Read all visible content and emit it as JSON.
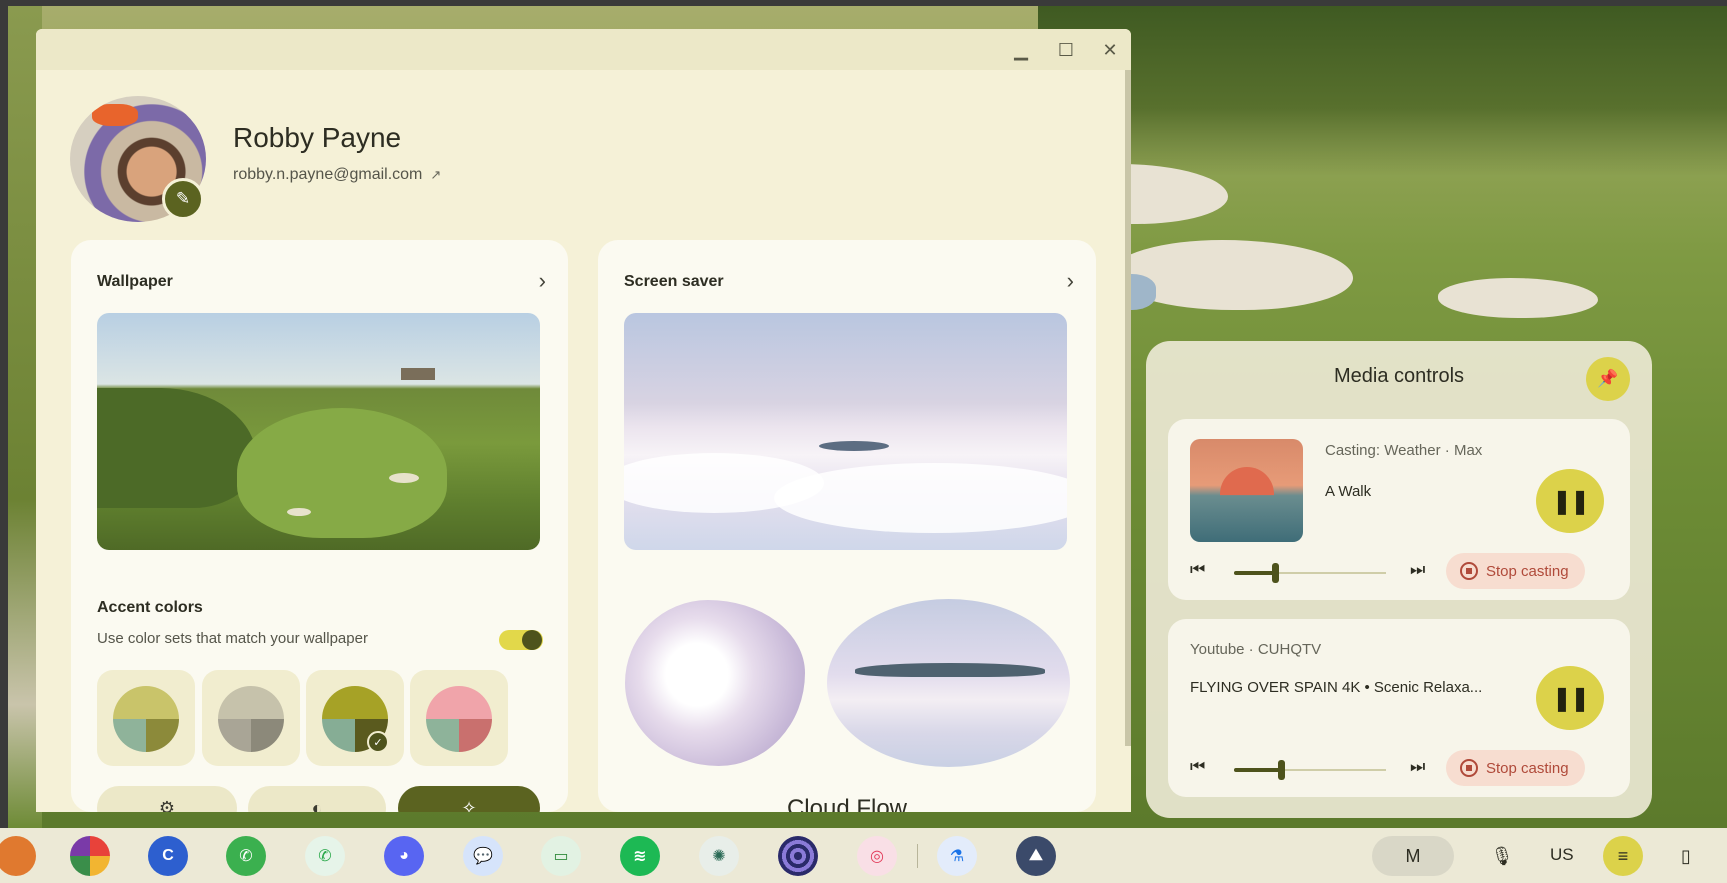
{
  "window": {
    "minimize_icon": "minimize-icon",
    "maximize_icon": "maximize-icon",
    "close_icon": "close-icon"
  },
  "profile": {
    "name": "Robby Payne",
    "email": "robby.n.payne@gmail.com",
    "edit_icon": "pencil-icon",
    "external_link_icon": "open-in-new-icon"
  },
  "wallpaper": {
    "title": "Wallpaper",
    "accent_title": "Accent colors",
    "accent_subtitle": "Use color sets that match your wallpaper",
    "match_wallpaper_toggle": true,
    "swatches": [
      {
        "top": "#c9c46a",
        "bl": "#8fb39a",
        "br": "#8c8a3a",
        "selected": false
      },
      {
        "top": "#c6c2ab",
        "bl": "#a9a596",
        "br": "#8c897a",
        "selected": false
      },
      {
        "top": "#a6a226",
        "bl": "#86ad95",
        "br": "#5a5a1e",
        "selected": true
      },
      {
        "top": "#f0a4aa",
        "bl": "#8eb39a",
        "br": "#c9706e",
        "selected": false
      }
    ],
    "mode_icons": [
      "gear-icon",
      "contrast-icon",
      "magic-wand-icon"
    ]
  },
  "screensaver": {
    "title": "Screen saver",
    "theme_label": "Cloud Flow"
  },
  "media": {
    "title": "Media controls",
    "items": [
      {
        "subtitle": "Casting: Weather · Max",
        "title": "A Walk",
        "stop_label": "Stop casting"
      },
      {
        "subtitle": "Youtube · CUHQTV",
        "title": "FLYING OVER SPAIN 4K • Scenic Relaxa...",
        "stop_label": "Stop casting"
      }
    ]
  },
  "shelf": {
    "apps": [
      "Chrome",
      "Canvas",
      "WhatsApp",
      "WhatsApp Web",
      "Discord",
      "Messages",
      "Screen recorder",
      "Spotify",
      "ChatGPT",
      "Mirror",
      "Creative Cloud",
      "Labs",
      "Gallery"
    ],
    "tray": {
      "keyboard": "US",
      "ime_label": "M"
    }
  },
  "colors": {
    "accent": "#dcd24a",
    "accent_dark": "#4e531c",
    "window_bg": "#f5f1d7",
    "stop_text": "#b04a3a"
  }
}
